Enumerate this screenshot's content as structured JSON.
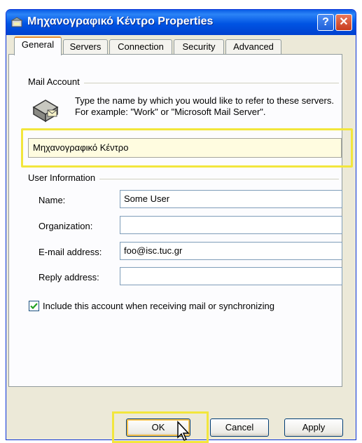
{
  "window": {
    "title": "Μηχανογραφικό Κέντρο Properties",
    "help_label": "?",
    "close_label": "✕"
  },
  "tabs": [
    {
      "label": "General",
      "active": true
    },
    {
      "label": "Servers",
      "active": false
    },
    {
      "label": "Connection",
      "active": false
    },
    {
      "label": "Security",
      "active": false
    },
    {
      "label": "Advanced",
      "active": false
    }
  ],
  "mail_account": {
    "heading": "Mail Account",
    "description": "Type the name by which you would like to refer to these servers.  For example: \"Work\" or \"Microsoft Mail Server\".",
    "account_name": "Μηχανογραφικό Κέντρο"
  },
  "user_info": {
    "heading": "User Information",
    "name_label": "Name:",
    "name_value": "Some User",
    "organization_label": "Organization:",
    "organization_value": "",
    "email_label": "E-mail address:",
    "email_value": "foo@isc.tuc.gr",
    "reply_label": "Reply address:",
    "reply_value": ""
  },
  "include_checkbox": {
    "label": "Include this account when receiving mail or synchronizing",
    "checked": true
  },
  "buttons": {
    "ok": "OK",
    "cancel": "Cancel",
    "apply": "Apply"
  },
  "colors": {
    "titlebar": "#0054e3",
    "highlight": "#f2e63c",
    "dialog_bg": "#ece9d8"
  }
}
